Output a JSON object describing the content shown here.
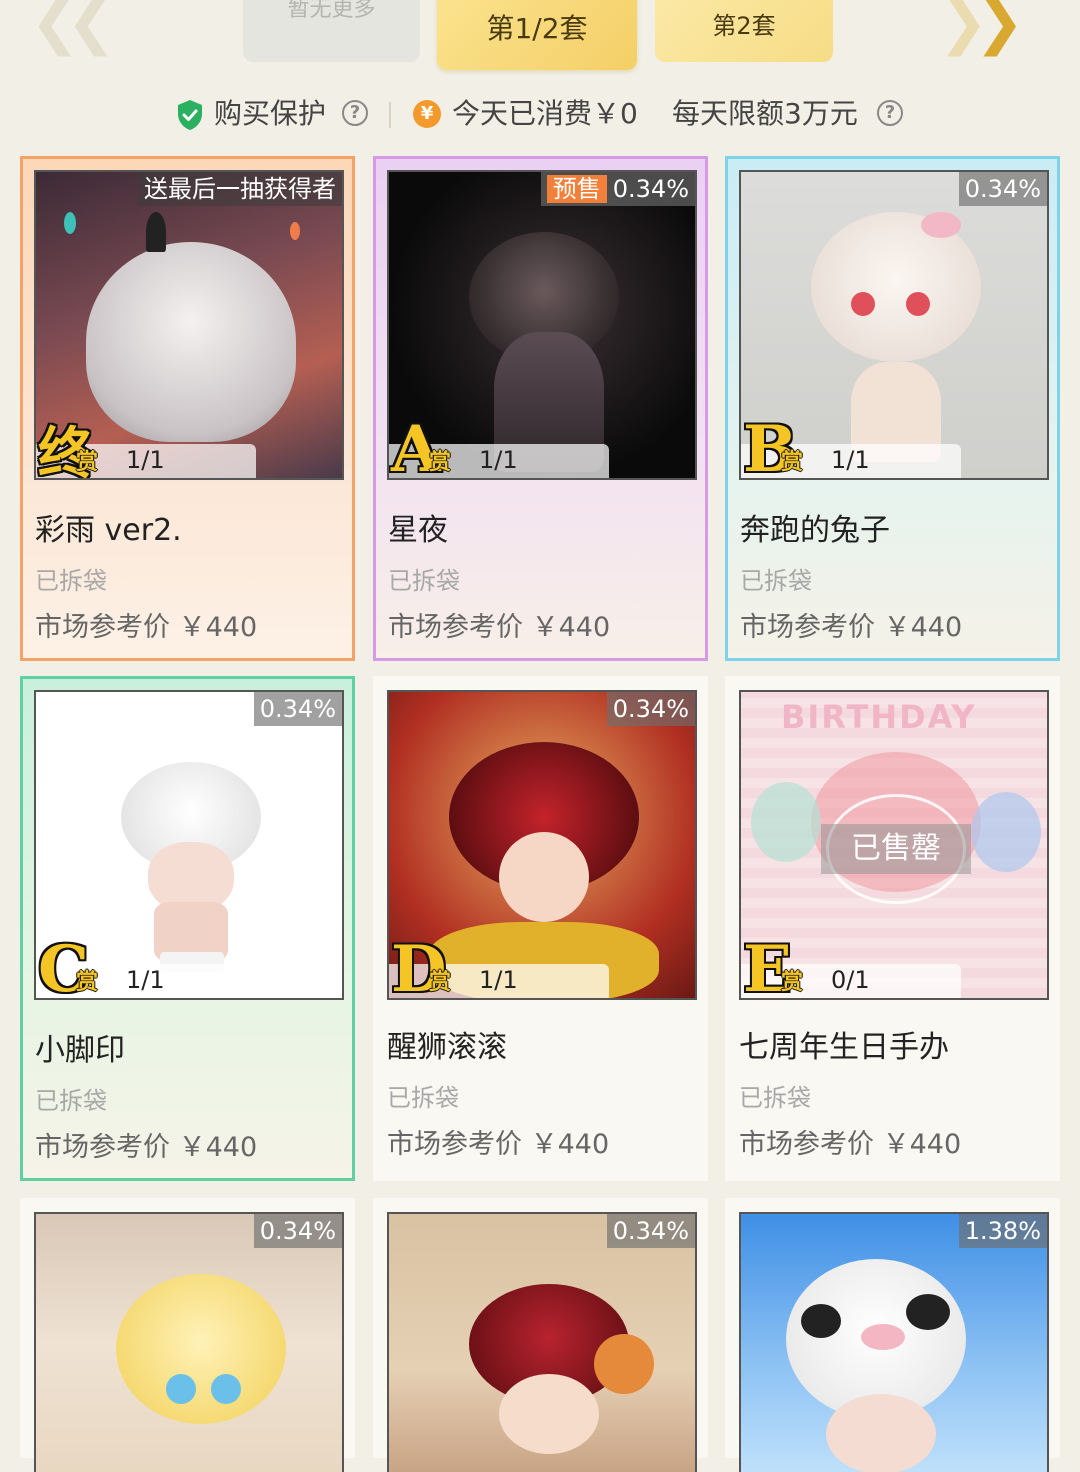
{
  "tabs": {
    "more": "暂无更多",
    "set_1_2": "第1/2套",
    "set_2": "第2套"
  },
  "infobar": {
    "protection": "购买保护",
    "spent_today": "今天已消费￥0",
    "daily_limit": "每天限额3万元"
  },
  "colors": {
    "orange_card": "#f4a368",
    "purple_card": "#d79be6",
    "cyan_card": "#7fd3e8",
    "green_card": "#5ed0a2",
    "accent_gold": "#f4cf66"
  },
  "cards": [
    {
      "badge": "送最后一抽获得者",
      "presale": "",
      "grade": "终",
      "grade_suffix": "赏",
      "count": "1/1",
      "name": "彩雨 ver2.",
      "status": "已拆袋",
      "price": "市场参考价 ￥440"
    },
    {
      "badge": "0.34%",
      "presale": "预售",
      "grade": "A",
      "grade_suffix": "赏",
      "count": "1/1",
      "name": "星夜",
      "status": "已拆袋",
      "price": "市场参考价 ￥440"
    },
    {
      "badge": "0.34%",
      "presale": "",
      "grade": "B",
      "grade_suffix": "赏",
      "count": "1/1",
      "name": "奔跑的兔子",
      "status": "已拆袋",
      "price": "市场参考价 ￥440"
    },
    {
      "badge": "0.34%",
      "presale": "",
      "grade": "C",
      "grade_suffix": "赏",
      "count": "1/1",
      "name": "小脚印",
      "status": "已拆袋",
      "price": "市场参考价 ￥440"
    },
    {
      "badge": "0.34%",
      "presale": "",
      "grade": "D",
      "grade_suffix": "赏",
      "count": "1/1",
      "name": "醒狮滚滚",
      "status": "已拆袋",
      "price": "市场参考价 ￥440"
    },
    {
      "badge": "",
      "presale": "",
      "grade": "E",
      "grade_suffix": "赏",
      "count": "0/1",
      "name": "七周年生日手办",
      "status": "已拆袋",
      "price": "市场参考价 ￥440",
      "soldout": "已售罄",
      "photo_text": "BIRTHDAY"
    },
    {
      "badge": "0.34%",
      "presale": ""
    },
    {
      "badge": "0.34%",
      "presale": ""
    },
    {
      "badge": "1.38%",
      "presale": ""
    }
  ]
}
